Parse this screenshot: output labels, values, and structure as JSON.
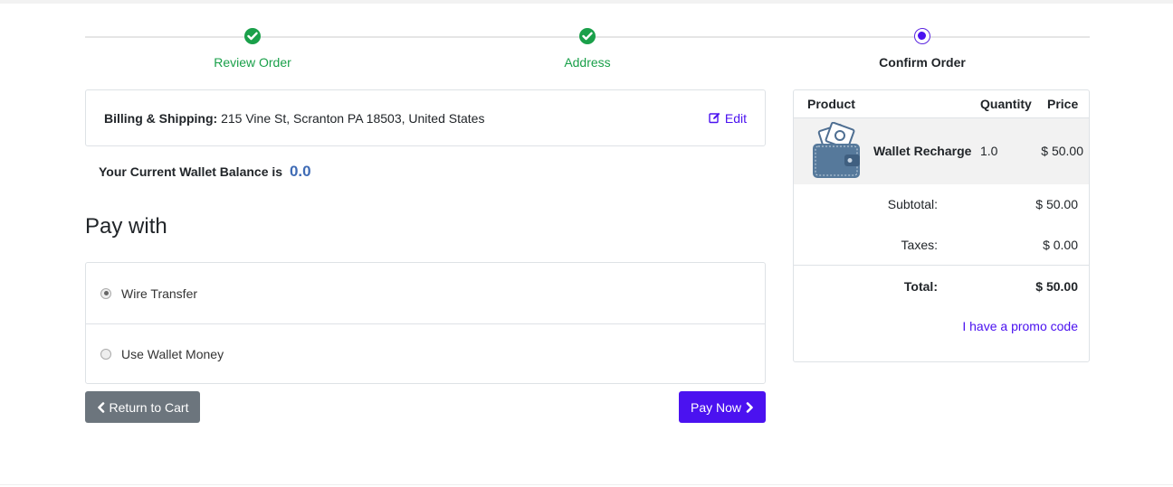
{
  "steps": [
    {
      "label": "Review Order",
      "status": "done"
    },
    {
      "label": "Address",
      "status": "done"
    },
    {
      "label": "Confirm Order",
      "status": "current"
    }
  ],
  "billing": {
    "label": "Billing & Shipping:",
    "address": " 215 Vine St, Scranton PA 18503, United States",
    "edit_label": "Edit"
  },
  "wallet": {
    "label": "Your Current Wallet Balance is",
    "amount": "0.0"
  },
  "payment": {
    "heading": "Pay with",
    "methods": [
      {
        "label": "Wire Transfer",
        "checked": true
      },
      {
        "label": "Use Wallet Money",
        "checked": false
      }
    ]
  },
  "actions": {
    "return_label": "Return to Cart",
    "pay_label": "Pay Now"
  },
  "summary": {
    "headers": {
      "product": "Product",
      "quantity": "Quantity",
      "price": "Price"
    },
    "items": [
      {
        "name": "Wallet Recharge",
        "quantity": "1.0",
        "price": "$ 50.00",
        "icon": "wallet-icon"
      }
    ],
    "subtotal_label": "Subtotal:",
    "subtotal": "$ 50.00",
    "taxes_label": "Taxes:",
    "taxes": "$ 0.00",
    "total_label": "Total:",
    "total": "$ 50.00",
    "promo_label": "I have a promo code"
  },
  "colors": {
    "accent": "#4b12f0",
    "success": "#1aa04a",
    "secondary_button": "#6c757d"
  }
}
